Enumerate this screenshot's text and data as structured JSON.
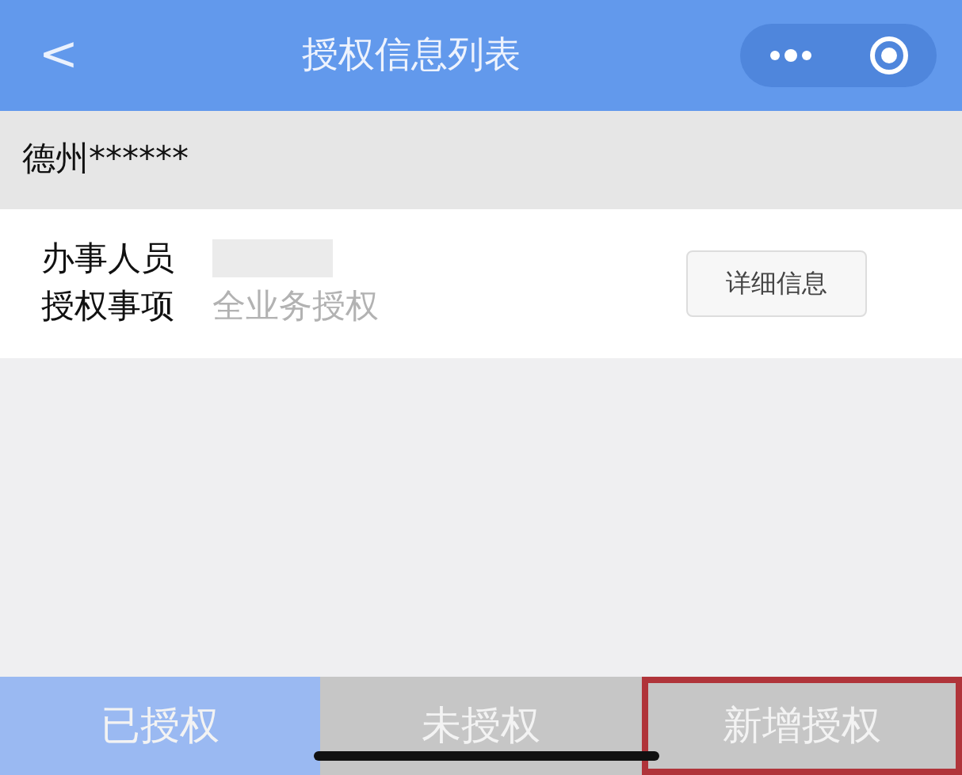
{
  "header": {
    "back": "<",
    "title": "授权信息列表"
  },
  "company": "德州******",
  "record": {
    "agent_label": "办事人员",
    "scope_label": "授权事项",
    "scope_value": "全业务授权",
    "detail_button": "详细信息"
  },
  "tabs": [
    {
      "label": "已授权",
      "selected": true,
      "highlighted": false
    },
    {
      "label": "未授权",
      "selected": false,
      "highlighted": false
    },
    {
      "label": "新增授权",
      "selected": false,
      "highlighted": true
    }
  ]
}
